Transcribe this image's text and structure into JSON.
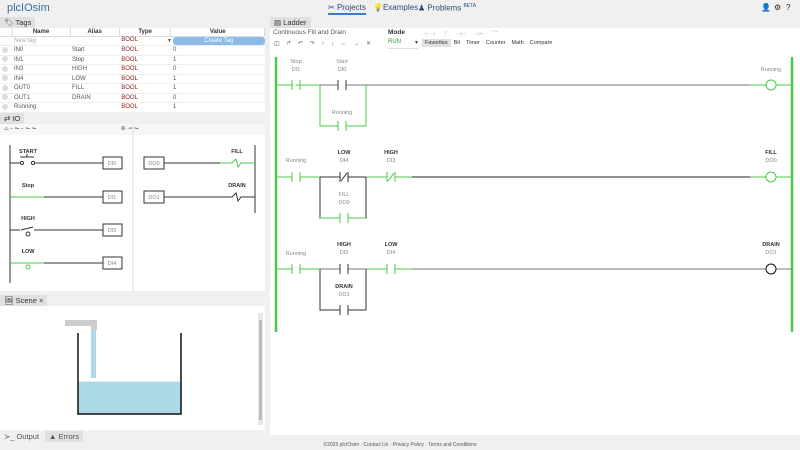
{
  "app": {
    "logo": "plcIOsim"
  },
  "nav": {
    "projects": "Projects",
    "examples": "Examples",
    "problems": "Problems",
    "beta": "BETA"
  },
  "tags": {
    "title": "Tags",
    "columns": [
      "Name",
      "Alias",
      "Type",
      "Value"
    ],
    "new_placeholder": "New tag",
    "new_type": "BOOL",
    "create_label": "Create Tag",
    "rows": [
      {
        "name": "IN0",
        "alias": "Start",
        "type": "BOOL",
        "value": "0"
      },
      {
        "name": "IN1",
        "alias": "Stop",
        "type": "BOOL",
        "value": "1"
      },
      {
        "name": "IN3",
        "alias": "HIGH",
        "type": "BOOL",
        "value": "0"
      },
      {
        "name": "IN4",
        "alias": "LOW",
        "type": "BOOL",
        "value": "1"
      },
      {
        "name": "OUT0",
        "alias": "FILL",
        "type": "BOOL",
        "value": "1"
      },
      {
        "name": "OUT1",
        "alias": "DRAIN",
        "type": "BOOL",
        "value": "0"
      },
      {
        "name": "Running",
        "alias": "",
        "type": "BOOL",
        "value": "1"
      }
    ]
  },
  "io": {
    "title": "IO",
    "inputs": [
      {
        "label": "START",
        "addr": "DI0"
      },
      {
        "label": "Stop",
        "addr": "DI1"
      },
      {
        "label": "HIGH",
        "addr": "DI3"
      },
      {
        "label": "LOW",
        "addr": "DI4"
      }
    ],
    "outputs": [
      {
        "label": "FILL",
        "addr": "DO0"
      },
      {
        "label": "DRAIN",
        "addr": "DO1"
      }
    ]
  },
  "scene": {
    "title": "Scene",
    "tank_level": 0.4
  },
  "bottom": {
    "output": "Output",
    "errors": "Errors"
  },
  "ladder": {
    "title": "Ladder",
    "program": "Continuous Fill and Drain",
    "mode_label": "Mode",
    "mode": "RUN",
    "categories": [
      "Favorites",
      "Bit",
      "Timer",
      "Counter",
      "Math",
      "Compare"
    ],
    "rungs": [
      {
        "contacts": [
          {
            "name": "Stop",
            "addr": "DI1"
          },
          {
            "name": "Start",
            "addr": "DI0"
          }
        ],
        "branch": {
          "name": "Running",
          "addr": ""
        },
        "coil": {
          "name": "Running",
          "addr": ""
        }
      },
      {
        "contacts": [
          {
            "name": "Running",
            "addr": ""
          },
          {
            "name": "LOW",
            "addr": "DI4"
          },
          {
            "name": "HIGH",
            "addr": "DI3"
          }
        ],
        "branch": {
          "name": "FILL",
          "addr": "DO0"
        },
        "coil": {
          "name": "FILL",
          "addr": "DO0"
        }
      },
      {
        "contacts": [
          {
            "name": "Running",
            "addr": ""
          },
          {
            "name": "HIGH",
            "addr": "DI3"
          },
          {
            "name": "LOW",
            "addr": "DI4"
          }
        ],
        "branch": {
          "name": "DRAIN",
          "addr": "DO1"
        },
        "coil": {
          "name": "DRAIN",
          "addr": "DO1"
        }
      }
    ],
    "colors": {
      "energized": "#4cc94c",
      "off": "#333333"
    }
  },
  "footer": {
    "copyright": "©2025 plcIOsim",
    "contact": "Contact Us",
    "privacy": "Privacy Policy",
    "terms": "Terms and Conditions"
  }
}
